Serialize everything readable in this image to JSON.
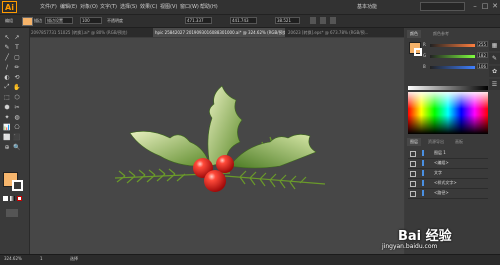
{
  "app": {
    "logo": "Ai"
  },
  "menu": [
    "文件(F)",
    "编辑(E)",
    "对象(O)",
    "文字(T)",
    "选择(S)",
    "效果(C)",
    "视图(V)",
    "窗口(W)",
    "帮助(H)"
  ],
  "workspace": "基本功能",
  "window_controls": [
    "–",
    "□",
    "✕"
  ],
  "control_bar": {
    "selection_label": "编组",
    "stroke_label": "描边",
    "fill_swatch": "#f6b36a",
    "field1": "描边设置",
    "field2": "100",
    "opacity": "不透明度",
    "x": "471.337",
    "y": "441.743",
    "w": "38.521"
  },
  "tabs": [
    {
      "label": "2097857731 51025 [转换].ai* @ 80% (RGB/预览)",
      "active": false
    },
    {
      "label": "hpic 25842027 2019093016088301000.ai* @ 324.62% (RGB/预览)",
      "active": true
    },
    {
      "label": "20623 [转换].eps* @ 673.78% (RGB/预...",
      "active": false
    }
  ],
  "tools": [
    "↖",
    "↗",
    "✎",
    "T",
    "╱",
    "▢",
    "∕",
    "✏",
    "◐",
    "⟲",
    "⤢",
    "✋",
    "⬚",
    "⬡",
    "⬢",
    "✂",
    "✦",
    "◍",
    "📊",
    "⎔",
    "⬜",
    "⬛",
    "⊕",
    "🔍"
  ],
  "tool_colors": {
    "fill": "#f7b66d",
    "stroke": "#ffffff"
  },
  "right_panel": {
    "tabs": [
      "颜色",
      "颜色参考"
    ],
    "color_swatch": "#f6b36a",
    "sliders": [
      {
        "label": "R",
        "value": "255",
        "color": "#ff7f3f"
      },
      {
        "label": "G",
        "value": "182",
        "color": "#7fff3f"
      },
      {
        "label": "B",
        "value": "106",
        "color": "#3f7fff"
      }
    ],
    "layer_tabs": [
      "图层",
      "资源导出",
      "画板"
    ],
    "layers": [
      {
        "label": "图层 1",
        "color": "#4a90e2"
      },
      {
        "label": "<编组>",
        "color": "#4a90e2"
      },
      {
        "label": "文字",
        "color": "#4a90e2"
      },
      {
        "label": "<样式文字>",
        "color": "#4a90e2"
      },
      {
        "label": "<路径>",
        "color": "#4a90e2"
      }
    ]
  },
  "status": {
    "zoom": "324.62%",
    "artboard": "1",
    "tool_name": "选择"
  },
  "watermark": {
    "text": "Bai 经验",
    "url": "jingyan.baidu.com"
  }
}
